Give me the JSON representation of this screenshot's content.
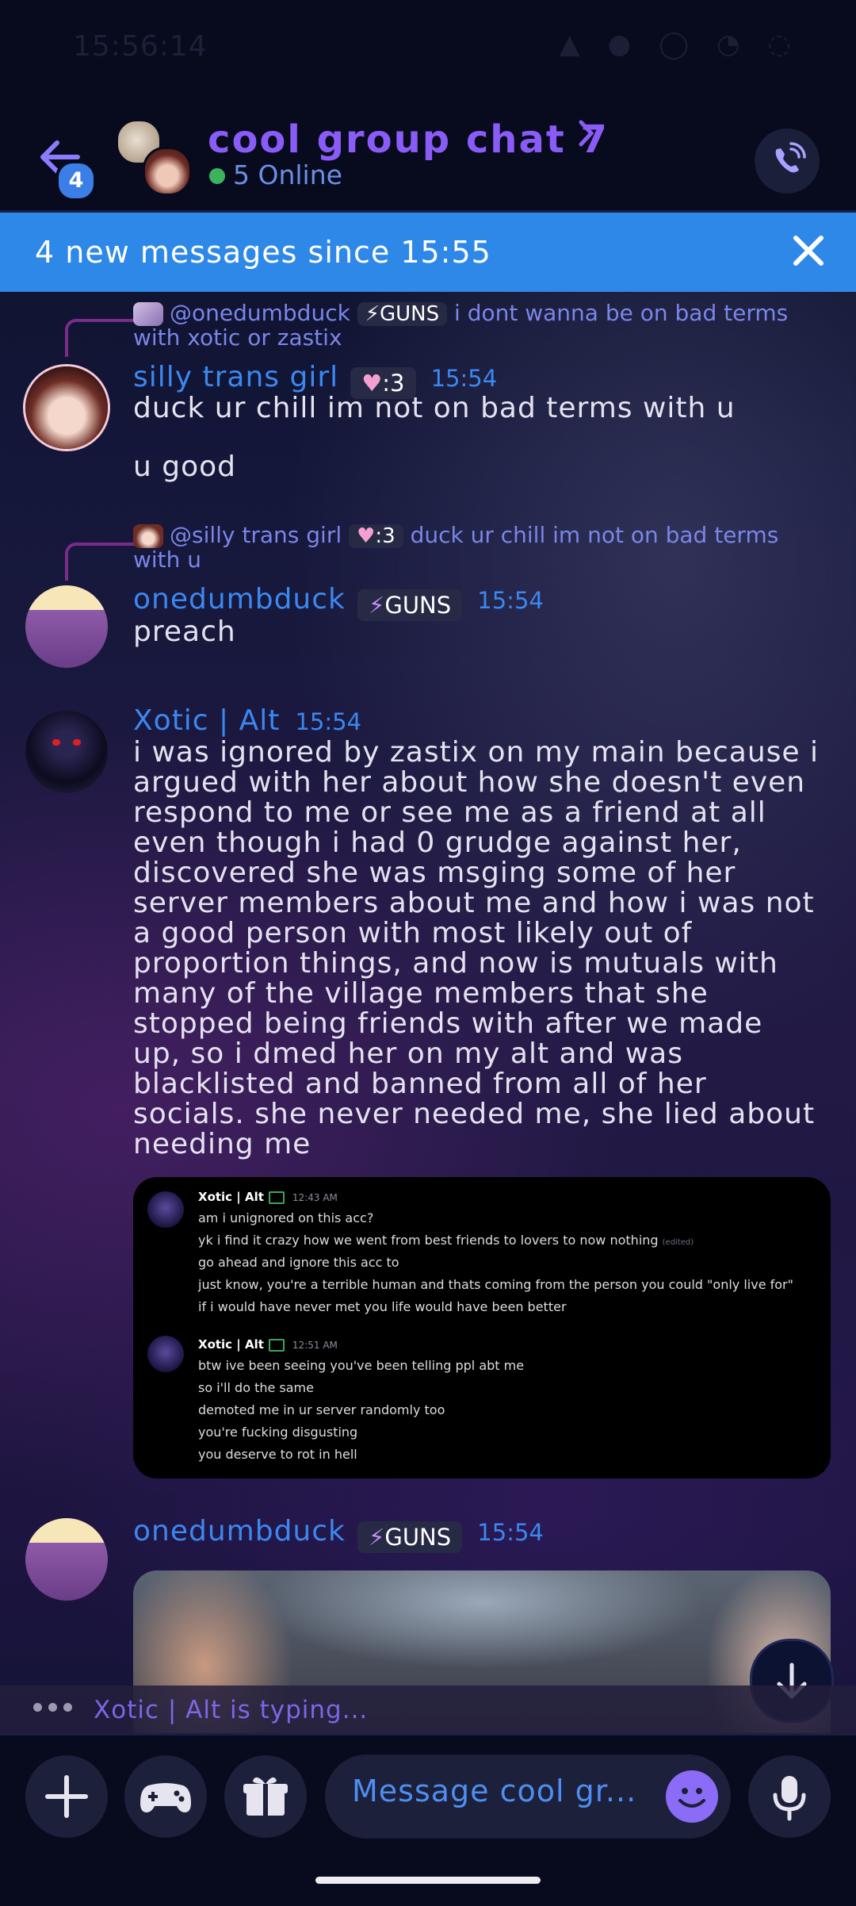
{
  "status_bar": {
    "time": "15:56:14"
  },
  "header": {
    "back_badge": "4",
    "title": "cool group chat 7",
    "online": "5 Online",
    "icons": {
      "back": "back-arrow-icon",
      "chevron": "chevron-right-icon",
      "call": "phone-call-icon"
    }
  },
  "new_messages": {
    "text": "4 new messages since 15:55",
    "close_icon": "close-icon"
  },
  "messages": [
    {
      "reply_to": {
        "user": "@onedumbduck",
        "tag": "GUNS",
        "text": "i dont wanna be on bad terms with xotic or zastix"
      },
      "author": "silly trans girl",
      "tag": ":3",
      "time": "15:54",
      "lines": [
        "duck ur chill im not on bad terms with u",
        "u good"
      ]
    },
    {
      "reply_to": {
        "user": "@silly trans girl",
        "tag": ":3",
        "text": "duck ur chill im not on bad terms with u"
      },
      "author": "onedumbduck",
      "tag": "GUNS",
      "time": "15:54",
      "lines": [
        "preach"
      ]
    },
    {
      "author": "Xotic | Alt",
      "time": "15:54",
      "lines": [
        "i was ignored by zastix on my main because i",
        "argued with her about how she doesn't even",
        "respond to me or see me as a friend at all",
        "even though i had 0 grudge against her,",
        "discovered she was msging some of her",
        "server members about me and how i was not",
        "a good person with most likely out of",
        "proportion things, and now is mutuals with",
        "many of the village members that she",
        "stopped being friends with after we made",
        "up, so i dmed her on my alt and was",
        "blacklisted and banned from all of her",
        "socials. she never needed me, she lied about",
        "needing me"
      ],
      "embed": [
        {
          "author": "Xotic | Alt",
          "time": "12:43 AM",
          "lines": [
            "am i unignored on this acc?",
            "yk i find it crazy how we went from best friends to lovers to now nothing",
            "go ahead and ignore this acc to",
            "just know, you're a terrible human and thats coming from the person you could \"only live for\"",
            "if i would have never met you life would have been better"
          ],
          "edited": "(edited)"
        },
        {
          "author": "Xotic | Alt",
          "time": "12:51 AM",
          "lines": [
            "btw ive been seeing you've been telling ppl abt me",
            "so i'll do the same",
            "demoted me in ur server randomly too",
            "you're fucking disgusting",
            "you deserve to rot in hell"
          ]
        }
      ]
    },
    {
      "author": "onedumbduck",
      "tag": "GUNS",
      "time": "15:54"
    }
  ],
  "typing": "Xotic | Alt is typing...",
  "composer": {
    "placeholder": "Message cool gr...",
    "icons": [
      "plus-icon",
      "gamepad-icon",
      "gift-icon",
      "emoji-icon",
      "microphone-icon"
    ]
  },
  "colors": {
    "accent": "#8a5cf7",
    "banner": "#2e88e8",
    "username": "#3b88f0",
    "background": "#070b1d"
  }
}
